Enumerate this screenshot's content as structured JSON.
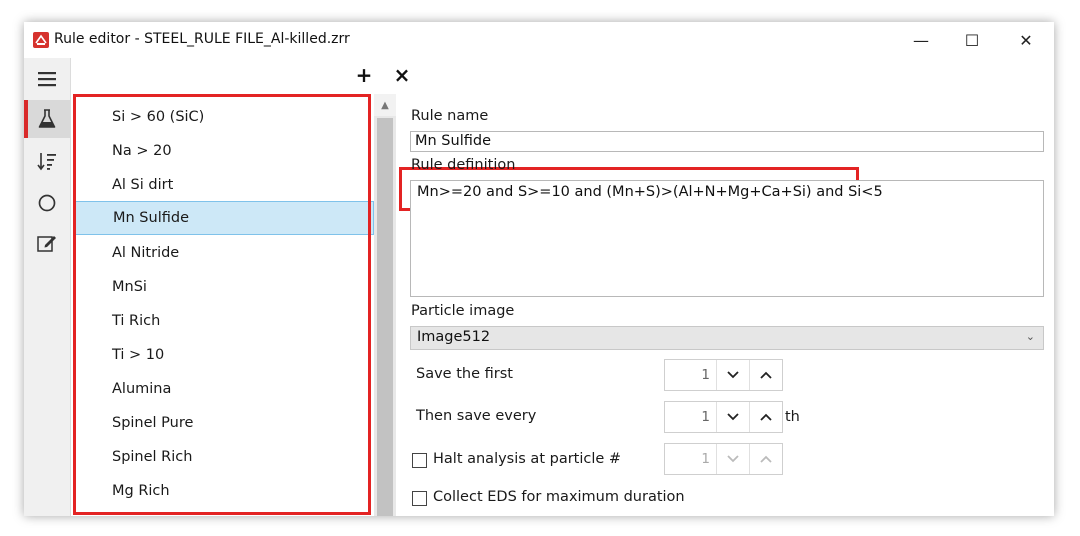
{
  "window": {
    "title": "Rule editor - STEEL_RULE FILE_Al-killed.zrr",
    "minimize": "—",
    "maximize": "☐",
    "close": "✕"
  },
  "rail": {
    "icons": [
      "hamburger-menu-icon",
      "flask-icon",
      "sort-icon",
      "circle-icon",
      "edit-icon"
    ],
    "active_icon": "flask-icon"
  },
  "list_toolbar": {
    "add": "+",
    "delete": "×"
  },
  "rules": [
    "Si > 60 (SiC)",
    "Na > 20",
    "Al Si dirt",
    "Mn Sulfide",
    "Al Nitride",
    "MnSi",
    "Ti Rich",
    "Ti > 10",
    "Alumina",
    "Spinel Pure",
    "Spinel Rich",
    "Mg Rich"
  ],
  "selected_rule": "Mn Sulfide",
  "form": {
    "rule_name_label": "Rule name",
    "rule_name_value": "Mn Sulfide",
    "rule_definition_label": "Rule definition",
    "rule_definition_value": "Mn>=20 and S>=10 and (Mn+S)>(Al+N+Mg+Ca+Si) and Si<5",
    "particle_image_label": "Particle image",
    "particle_image_value": "Image512",
    "save_first_label": "Save the first",
    "save_first_value": "1",
    "then_save_every_label": "Then save every",
    "then_save_every_value": "1",
    "then_save_every_suffix": "th",
    "halt_label": "Halt analysis at particle #",
    "halt_value": "1",
    "halt_checked": false,
    "collect_eds_label": "Collect EDS for maximum duration",
    "collect_eds_checked": false
  },
  "colors": {
    "highlight_red": "#e32323",
    "selection_bg": "#cde8f7",
    "active_rail_accent": "#d92a2a"
  }
}
